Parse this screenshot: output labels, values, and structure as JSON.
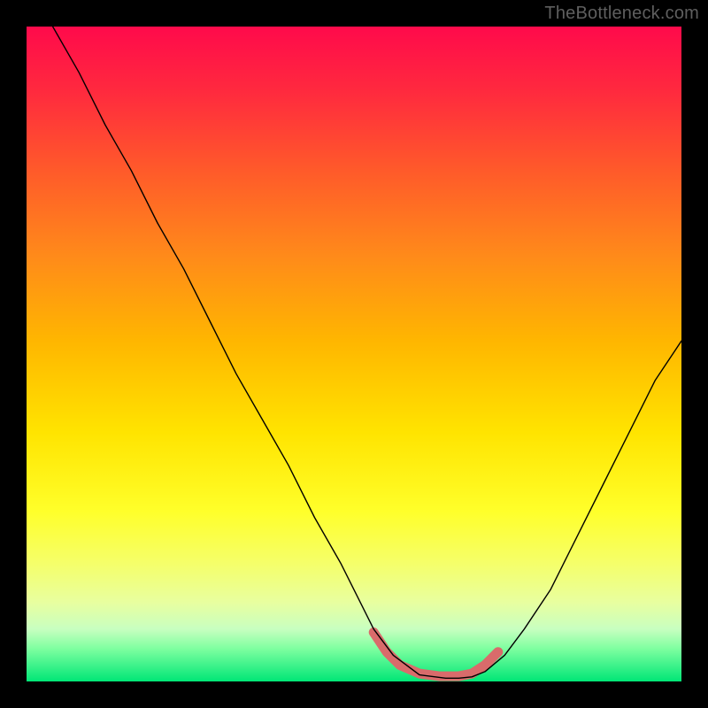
{
  "watermark": "TheBottleneck.com",
  "chart_data": {
    "type": "line",
    "title": "",
    "xlabel": "",
    "ylabel": "",
    "xlim": [
      0,
      100
    ],
    "ylim": [
      0,
      100
    ],
    "grid": false,
    "legend": false,
    "series": [
      {
        "name": "curve",
        "color": "#000000",
        "stroke_width": 1.4,
        "x": [
          4,
          8,
          12,
          16,
          20,
          24,
          28,
          32,
          36,
          40,
          44,
          48,
          51,
          53,
          56,
          60,
          64,
          66,
          68,
          70,
          73,
          76,
          80,
          84,
          88,
          92,
          96,
          100
        ],
        "values": [
          100,
          93,
          85,
          78,
          70,
          63,
          55,
          47,
          40,
          33,
          25,
          18,
          12,
          8,
          4,
          1,
          0.5,
          0.5,
          0.7,
          1.5,
          4,
          8,
          14,
          22,
          30,
          38,
          46,
          52
        ]
      },
      {
        "name": "highlight",
        "color": "#d96b6b",
        "stroke_width": 11,
        "x": [
          53,
          55,
          57,
          60,
          63,
          66,
          68,
          70,
          72
        ],
        "values": [
          7.5,
          4.5,
          2.5,
          1.2,
          0.8,
          0.8,
          1.2,
          2.5,
          4.5
        ]
      }
    ],
    "background_gradient": {
      "type": "vertical",
      "stops": [
        {
          "pos": 0.0,
          "color": "#ff0a4b"
        },
        {
          "pos": 0.1,
          "color": "#ff2a3e"
        },
        {
          "pos": 0.22,
          "color": "#ff5a2a"
        },
        {
          "pos": 0.35,
          "color": "#ff8a1a"
        },
        {
          "pos": 0.48,
          "color": "#ffb600"
        },
        {
          "pos": 0.62,
          "color": "#ffe400"
        },
        {
          "pos": 0.74,
          "color": "#ffff2a"
        },
        {
          "pos": 0.82,
          "color": "#f5ff6a"
        },
        {
          "pos": 0.88,
          "color": "#e8ffa0"
        },
        {
          "pos": 0.92,
          "color": "#c8ffc0"
        },
        {
          "pos": 0.95,
          "color": "#7effa0"
        },
        {
          "pos": 1.0,
          "color": "#00e676"
        }
      ]
    }
  }
}
